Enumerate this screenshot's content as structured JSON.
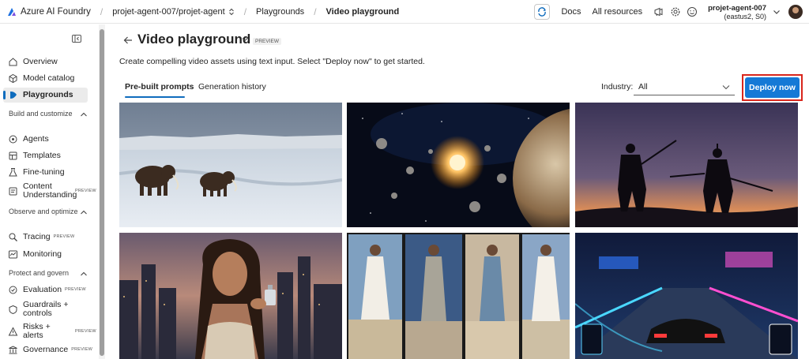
{
  "topbar": {
    "brand": "Azure AI Foundry",
    "project": "projet-agent-007/projet-agent",
    "crumb_playgrounds": "Playgrounds",
    "crumb_current": "Video playground",
    "docs": "Docs",
    "all_resources": "All resources",
    "user_name": "projet-agent-007",
    "user_region": "(eastus2, S0)"
  },
  "sidebar": {
    "overview": "Overview",
    "model_catalog": "Model catalog",
    "playgrounds": "Playgrounds",
    "section_build": "Build and customize",
    "agents": "Agents",
    "templates": "Templates",
    "fine_tuning": "Fine-tuning",
    "content_understanding": "Content Understanding",
    "section_observe": "Observe and optimize",
    "tracing": "Tracing",
    "monitoring": "Monitoring",
    "section_protect": "Protect and govern",
    "evaluation": "Evaluation",
    "guardrails": "Guardrails + controls",
    "risks": "Risks + alerts",
    "governance": "Governance",
    "preview_badge": "PREVIEW"
  },
  "main": {
    "title": "Video playground",
    "title_badge": "PREVIEW",
    "description": "Create compelling video assets using text input. Select \"Deploy now\" to get started.",
    "tab_prebuilt": "Pre-built prompts",
    "tab_history": "Generation history",
    "industry_label": "Industry:",
    "industry_value": "All",
    "deploy_label": "Deploy now"
  },
  "colors": {
    "accent": "#0f6cbd",
    "deploy_button": "#1579d6",
    "highlight": "#d9261c"
  }
}
